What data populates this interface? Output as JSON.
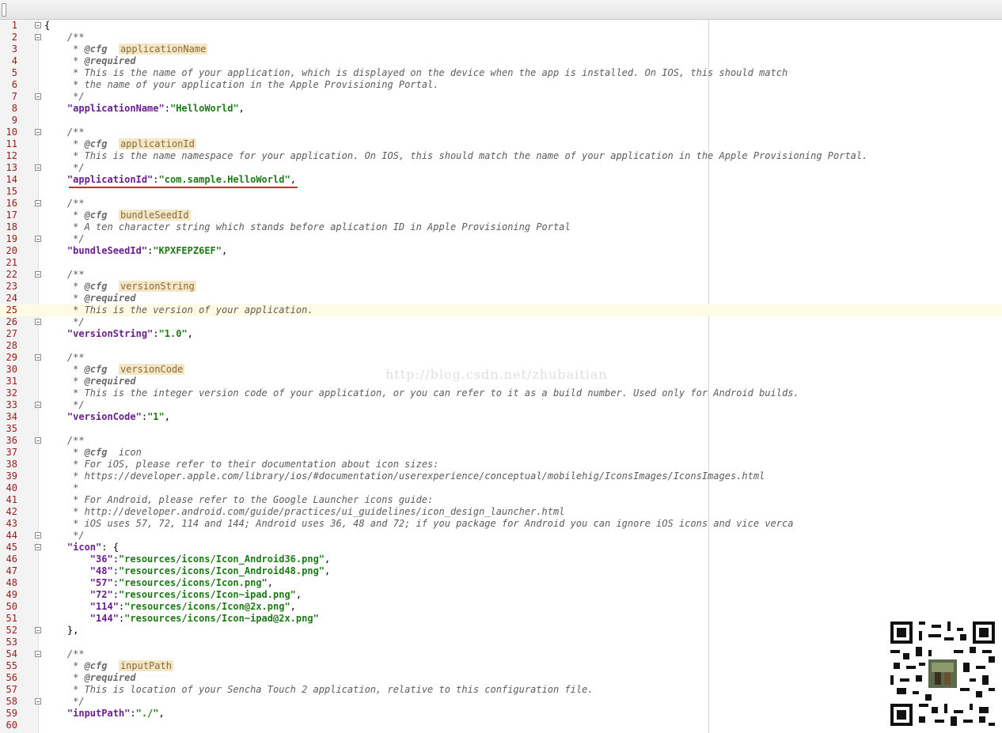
{
  "editor": {
    "lines": [
      {
        "n": "1",
        "parts": [
          {
            "c": "p",
            "t": "{"
          }
        ],
        "fold": true
      },
      {
        "n": "2",
        "parts": [
          {
            "c": "cm",
            "t": "    /**"
          }
        ],
        "fold": true
      },
      {
        "n": "3",
        "parts": [
          {
            "c": "cm",
            "t": "     * "
          },
          {
            "c": "tag",
            "t": "@cfg"
          },
          {
            "c": "cm",
            "t": "  "
          },
          {
            "c": "val",
            "t": "applicationName"
          }
        ]
      },
      {
        "n": "4",
        "parts": [
          {
            "c": "cm",
            "t": "     * "
          },
          {
            "c": "tag",
            "t": "@required"
          }
        ]
      },
      {
        "n": "5",
        "parts": [
          {
            "c": "cm",
            "t": "     * This is the name of your application, which is displayed on the device when the app is installed. On IOS, this should match"
          }
        ]
      },
      {
        "n": "6",
        "parts": [
          {
            "c": "cm",
            "t": "     * the name of your application in the Apple Provisioning Portal."
          }
        ]
      },
      {
        "n": "7",
        "parts": [
          {
            "c": "cm",
            "t": "     */"
          }
        ],
        "fold": true
      },
      {
        "n": "8",
        "parts": [
          {
            "c": "p",
            "t": "    "
          },
          {
            "c": "key",
            "t": "\"applicationName\""
          },
          {
            "c": "p",
            "t": ":"
          },
          {
            "c": "str",
            "t": "\"HelloWorld\""
          },
          {
            "c": "p",
            "t": ","
          }
        ]
      },
      {
        "n": "9",
        "parts": []
      },
      {
        "n": "10",
        "parts": [
          {
            "c": "cm",
            "t": "    /**"
          }
        ],
        "fold": true
      },
      {
        "n": "11",
        "parts": [
          {
            "c": "cm",
            "t": "     * "
          },
          {
            "c": "tag",
            "t": "@cfg"
          },
          {
            "c": "cm",
            "t": "  "
          },
          {
            "c": "val",
            "t": "applicationId"
          }
        ]
      },
      {
        "n": "12",
        "parts": [
          {
            "c": "cm",
            "t": "     * This is the name namespace for your application. On IOS, this should match the name of your application in the Apple Provisioning Portal."
          }
        ]
      },
      {
        "n": "13",
        "parts": [
          {
            "c": "cm",
            "t": "     */"
          }
        ],
        "fold": true
      },
      {
        "n": "14",
        "parts": [
          {
            "c": "p",
            "t": "    "
          },
          {
            "c": "key",
            "t": "\"applicationId\""
          },
          {
            "c": "p",
            "t": ":"
          },
          {
            "c": "str",
            "t": "\"com.sample.HelloWorld\""
          },
          {
            "c": "p",
            "t": ","
          }
        ]
      },
      {
        "n": "15",
        "parts": []
      },
      {
        "n": "16",
        "parts": [
          {
            "c": "cm",
            "t": "    /**"
          }
        ],
        "fold": true
      },
      {
        "n": "17",
        "parts": [
          {
            "c": "cm",
            "t": "     * "
          },
          {
            "c": "tag",
            "t": "@cfg"
          },
          {
            "c": "cm",
            "t": "  "
          },
          {
            "c": "val",
            "t": "bundleSeedId"
          }
        ]
      },
      {
        "n": "18",
        "parts": [
          {
            "c": "cm",
            "t": "     * A ten character string which stands before aplication ID in Apple Provisioning Portal"
          }
        ]
      },
      {
        "n": "19",
        "parts": [
          {
            "c": "cm",
            "t": "     */"
          }
        ],
        "fold": true
      },
      {
        "n": "20",
        "parts": [
          {
            "c": "p",
            "t": "    "
          },
          {
            "c": "key",
            "t": "\"bundleSeedId\""
          },
          {
            "c": "p",
            "t": ":"
          },
          {
            "c": "str",
            "t": "\"KPXFEPZ6EF\""
          },
          {
            "c": "p",
            "t": ","
          }
        ]
      },
      {
        "n": "21",
        "parts": []
      },
      {
        "n": "22",
        "parts": [
          {
            "c": "cm",
            "t": "    /**"
          }
        ],
        "fold": true
      },
      {
        "n": "23",
        "parts": [
          {
            "c": "cm",
            "t": "     * "
          },
          {
            "c": "tag",
            "t": "@cfg"
          },
          {
            "c": "cm",
            "t": "  "
          },
          {
            "c": "val",
            "t": "versionString"
          }
        ]
      },
      {
        "n": "24",
        "parts": [
          {
            "c": "cm",
            "t": "     * "
          },
          {
            "c": "tag",
            "t": "@required"
          }
        ]
      },
      {
        "n": "25",
        "parts": [
          {
            "c": "cm",
            "t": "     * This is the version of your application."
          }
        ],
        "caret": true
      },
      {
        "n": "26",
        "parts": [
          {
            "c": "cm",
            "t": "     */"
          }
        ],
        "fold": true
      },
      {
        "n": "27",
        "parts": [
          {
            "c": "p",
            "t": "    "
          },
          {
            "c": "key",
            "t": "\"versionString\""
          },
          {
            "c": "p",
            "t": ":"
          },
          {
            "c": "str",
            "t": "\"1.0\""
          },
          {
            "c": "p",
            "t": ","
          }
        ]
      },
      {
        "n": "28",
        "parts": []
      },
      {
        "n": "29",
        "parts": [
          {
            "c": "cm",
            "t": "    /**"
          }
        ],
        "fold": true
      },
      {
        "n": "30",
        "parts": [
          {
            "c": "cm",
            "t": "     * "
          },
          {
            "c": "tag",
            "t": "@cfg"
          },
          {
            "c": "cm",
            "t": "  "
          },
          {
            "c": "val",
            "t": "versionCode"
          }
        ]
      },
      {
        "n": "31",
        "parts": [
          {
            "c": "cm",
            "t": "     * "
          },
          {
            "c": "tag",
            "t": "@required"
          }
        ]
      },
      {
        "n": "32",
        "parts": [
          {
            "c": "cm",
            "t": "     * This is the integer version code of your application, or you can refer to it as a build number. Used only for Android builds."
          }
        ]
      },
      {
        "n": "33",
        "parts": [
          {
            "c": "cm",
            "t": "     */"
          }
        ],
        "fold": true
      },
      {
        "n": "34",
        "parts": [
          {
            "c": "p",
            "t": "    "
          },
          {
            "c": "key",
            "t": "\"versionCode\""
          },
          {
            "c": "p",
            "t": ":"
          },
          {
            "c": "str",
            "t": "\"1\""
          },
          {
            "c": "p",
            "t": ","
          }
        ]
      },
      {
        "n": "35",
        "parts": []
      },
      {
        "n": "36",
        "parts": [
          {
            "c": "cm",
            "t": "    /**"
          }
        ],
        "fold": true
      },
      {
        "n": "37",
        "parts": [
          {
            "c": "cm",
            "t": "     * "
          },
          {
            "c": "tag",
            "t": "@cfg"
          },
          {
            "c": "cm",
            "t": "  icon"
          }
        ]
      },
      {
        "n": "38",
        "parts": [
          {
            "c": "cm",
            "t": "     * For iOS, please refer to their documentation about icon sizes:"
          }
        ]
      },
      {
        "n": "39",
        "parts": [
          {
            "c": "cm",
            "t": "     * https://developer.apple.com/library/ios/#documentation/userexperience/conceptual/mobilehig/IconsImages/IconsImages.html"
          }
        ]
      },
      {
        "n": "40",
        "parts": [
          {
            "c": "cm",
            "t": "     *"
          }
        ]
      },
      {
        "n": "41",
        "parts": [
          {
            "c": "cm",
            "t": "     * For Android, please refer to the Google Launcher icons guide:"
          }
        ]
      },
      {
        "n": "42",
        "parts": [
          {
            "c": "cm",
            "t": "     * http://developer.android.com/guide/practices/ui_guidelines/icon_design_launcher.html"
          }
        ]
      },
      {
        "n": "43",
        "parts": [
          {
            "c": "cm",
            "t": "     * iOS uses 57, 72, 114 and 144; Android uses 36, 48 and 72; if you package for Android you can ignore iOS icons and vice verca"
          }
        ]
      },
      {
        "n": "44",
        "parts": [
          {
            "c": "cm",
            "t": "     */"
          }
        ],
        "fold": true
      },
      {
        "n": "45",
        "parts": [
          {
            "c": "p",
            "t": "    "
          },
          {
            "c": "key",
            "t": "\"icon\""
          },
          {
            "c": "p",
            "t": ": {"
          }
        ],
        "fold": true
      },
      {
        "n": "46",
        "parts": [
          {
            "c": "p",
            "t": "        "
          },
          {
            "c": "key",
            "t": "\"36\""
          },
          {
            "c": "p",
            "t": ":"
          },
          {
            "c": "str",
            "t": "\"resources/icons/Icon_Android36.png\""
          },
          {
            "c": "p",
            "t": ","
          }
        ]
      },
      {
        "n": "47",
        "parts": [
          {
            "c": "p",
            "t": "        "
          },
          {
            "c": "key",
            "t": "\"48\""
          },
          {
            "c": "p",
            "t": ":"
          },
          {
            "c": "str",
            "t": "\"resources/icons/Icon_Android48.png\""
          },
          {
            "c": "p",
            "t": ","
          }
        ]
      },
      {
        "n": "48",
        "parts": [
          {
            "c": "p",
            "t": "        "
          },
          {
            "c": "key",
            "t": "\"57\""
          },
          {
            "c": "p",
            "t": ":"
          },
          {
            "c": "str",
            "t": "\"resources/icons/Icon.png\""
          },
          {
            "c": "p",
            "t": ","
          }
        ]
      },
      {
        "n": "49",
        "parts": [
          {
            "c": "p",
            "t": "        "
          },
          {
            "c": "key",
            "t": "\"72\""
          },
          {
            "c": "p",
            "t": ":"
          },
          {
            "c": "str",
            "t": "\"resources/icons/Icon~ipad.png\""
          },
          {
            "c": "p",
            "t": ","
          }
        ]
      },
      {
        "n": "50",
        "parts": [
          {
            "c": "p",
            "t": "        "
          },
          {
            "c": "key",
            "t": "\"114\""
          },
          {
            "c": "p",
            "t": ":"
          },
          {
            "c": "str",
            "t": "\"resources/icons/Icon@2x.png\""
          },
          {
            "c": "p",
            "t": ","
          }
        ]
      },
      {
        "n": "51",
        "parts": [
          {
            "c": "p",
            "t": "        "
          },
          {
            "c": "key",
            "t": "\"144\""
          },
          {
            "c": "p",
            "t": ":"
          },
          {
            "c": "str",
            "t": "\"resources/icons/Icon~ipad@2x.png\""
          }
        ]
      },
      {
        "n": "52",
        "parts": [
          {
            "c": "p",
            "t": "    },"
          }
        ],
        "fold": true
      },
      {
        "n": "53",
        "parts": []
      },
      {
        "n": "54",
        "parts": [
          {
            "c": "cm",
            "t": "    /**"
          }
        ],
        "fold": true
      },
      {
        "n": "55",
        "parts": [
          {
            "c": "cm",
            "t": "     * "
          },
          {
            "c": "tag",
            "t": "@cfg"
          },
          {
            "c": "cm",
            "t": "  "
          },
          {
            "c": "val",
            "t": "inputPath"
          }
        ]
      },
      {
        "n": "56",
        "parts": [
          {
            "c": "cm",
            "t": "     * "
          },
          {
            "c": "tag",
            "t": "@required"
          }
        ]
      },
      {
        "n": "57",
        "parts": [
          {
            "c": "cm",
            "t": "     * This is location of your Sencha Touch 2 application, relative to this configuration file."
          }
        ]
      },
      {
        "n": "58",
        "parts": [
          {
            "c": "cm",
            "t": "     */"
          }
        ],
        "fold": true
      },
      {
        "n": "59",
        "parts": [
          {
            "c": "p",
            "t": "    "
          },
          {
            "c": "key",
            "t": "\"inputPath\""
          },
          {
            "c": "p",
            "t": ":"
          },
          {
            "c": "str",
            "t": "\"./\""
          },
          {
            "c": "p",
            "t": ","
          }
        ]
      },
      {
        "n": "60",
        "parts": []
      }
    ]
  },
  "watermark": "http://blog.csdn.net/zhubaitian",
  "colors": {
    "line_number": "#9a1a1a",
    "key": "#6a1f8c",
    "string": "#1e7a17",
    "comment": "#5c5c5c",
    "annotation_underline": "#d6262b",
    "caret_line": "#fffae3"
  }
}
